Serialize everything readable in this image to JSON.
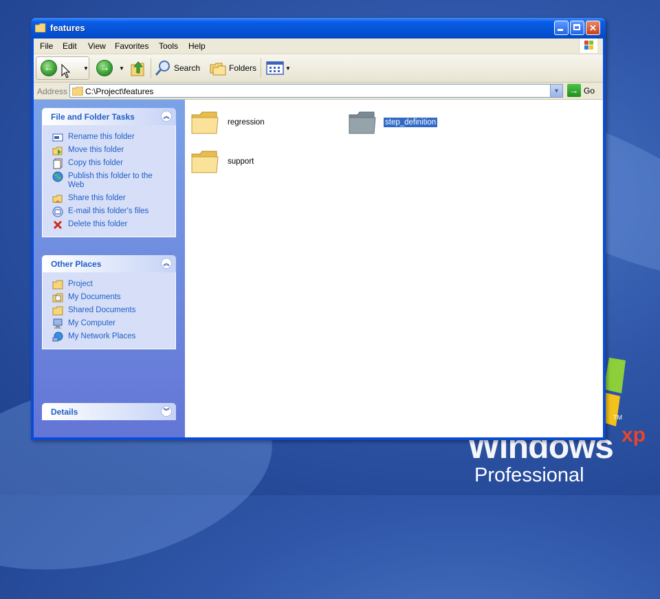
{
  "window": {
    "title": "features",
    "menu": [
      "File",
      "Edit",
      "View",
      "Favorites",
      "Tools",
      "Help"
    ],
    "toolbar": {
      "search_label": "Search",
      "folders_label": "Folders"
    },
    "address": {
      "label": "Address",
      "value": "C:\\Project\\features",
      "go_label": "Go"
    }
  },
  "task_pane": {
    "file_folder_tasks": {
      "title": "File and Folder Tasks",
      "items": [
        {
          "label": "Rename this folder",
          "icon": "rename-icon"
        },
        {
          "label": "Move this folder",
          "icon": "move-icon"
        },
        {
          "label": "Copy this folder",
          "icon": "copy-icon"
        },
        {
          "label": "Publish this folder to the Web",
          "icon": "globe-icon"
        },
        {
          "label": "Share this folder",
          "icon": "share-icon"
        },
        {
          "label": "E-mail this folder's files",
          "icon": "email-icon"
        },
        {
          "label": "Delete this folder",
          "icon": "delete-icon"
        }
      ]
    },
    "other_places": {
      "title": "Other Places",
      "items": [
        {
          "label": "Project",
          "icon": "folder-icon"
        },
        {
          "label": "My Documents",
          "icon": "my-documents-icon"
        },
        {
          "label": "Shared Documents",
          "icon": "folder-icon"
        },
        {
          "label": "My Computer",
          "icon": "my-computer-icon"
        },
        {
          "label": "My Network Places",
          "icon": "network-icon"
        }
      ]
    },
    "details": {
      "title": "Details"
    }
  },
  "content": {
    "folders": [
      {
        "name": "regression",
        "selected": false
      },
      {
        "name": "step_definition",
        "selected": true
      },
      {
        "name": "support",
        "selected": false
      }
    ]
  },
  "desktop": {
    "logo_brand": "Windows",
    "logo_xp": "xp",
    "logo_edition": "Professional",
    "logo_tm": "TM"
  },
  "colors": {
    "titlebar": "#0654d6",
    "taskpane": "#6f8ddd",
    "link": "#215dc6",
    "selection": "#316ac5"
  }
}
